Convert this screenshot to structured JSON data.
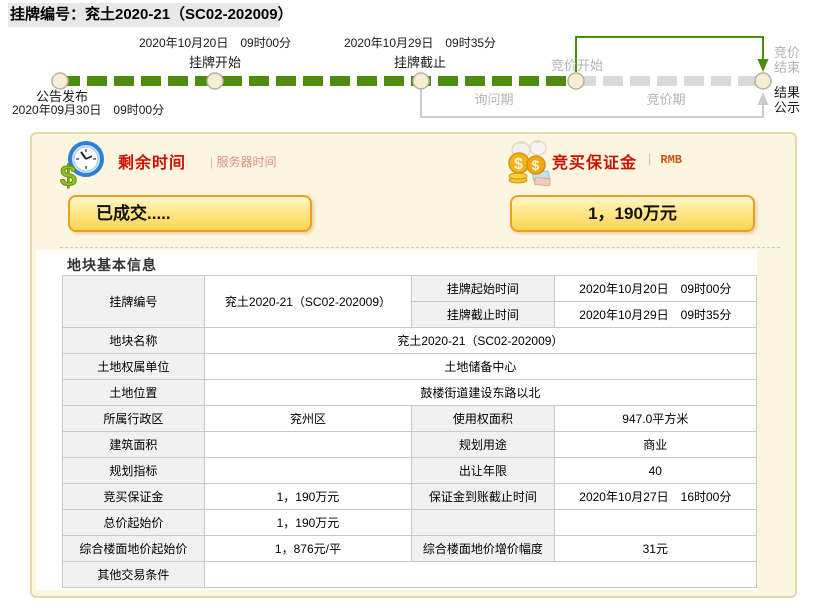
{
  "header": {
    "listing_label": "挂牌编号：兖土2020-21（SC02-202009）"
  },
  "timeline": {
    "announce_label": "公告发布",
    "announce_date": "2020年09月30日　09时00分",
    "listing_start_date": "2020年10月20日　09时00分",
    "listing_start_label": "挂牌开始",
    "listing_end_date": "2020年10月29日　09时35分",
    "listing_end_label": "挂牌截止",
    "bid_start_label": "竞价开始",
    "inquiry_label": "询问期",
    "bidding_label": "竞价期",
    "bid_end_line1": "竞价",
    "bid_end_line2": "结束",
    "result_line1": "结果",
    "result_line2": "公示",
    "colors": {
      "active_green": "#4e8c0e",
      "inactive_gray": "#d9d9d9",
      "node_fill": "#f7edd2"
    }
  },
  "status_panel": {
    "remaining_time_title": "剩余时间",
    "server_time_pipe": "|",
    "server_time_label": "服务器时间",
    "status_value": "已成交.....",
    "deposit_title": "竞买保证金",
    "currency_pipe": "|",
    "currency_label": "RMB",
    "deposit_value": "1，190万元",
    "clock_icon": "clock-with-dollar",
    "money_icon": "money-bags",
    "colors": {
      "title_red": "#cc1100",
      "button_border": "#ef9f1f",
      "panel_bg": "#fcf6e1"
    }
  },
  "info_table": {
    "section_title": "地块基本信息",
    "rows": {
      "listing_no": {
        "label": "挂牌编号",
        "value": "兖土2020-21（SC02-202009）"
      },
      "start_time": {
        "label": "挂牌起始时间",
        "value": "2020年10月20日　09时00分"
      },
      "end_time": {
        "label": "挂牌截止时间",
        "value": "2020年10月29日　09时35分"
      },
      "parcel_name": {
        "label": "地块名称",
        "value": "兖土2020-21（SC02-202009）"
      },
      "owner": {
        "label": "土地权属单位",
        "value": "土地储备中心"
      },
      "location": {
        "label": "土地位置",
        "value": "鼓楼街道建设东路以北"
      },
      "district": {
        "label": "所属行政区",
        "value": "兖州区"
      },
      "use_area": {
        "label": "使用权面积",
        "value": "947.0平方米"
      },
      "building_area": {
        "label": "建筑面积",
        "value": ""
      },
      "planned_use": {
        "label": "规划用途",
        "value": "商业"
      },
      "plan_index": {
        "label": "规划指标",
        "value": ""
      },
      "tenure_years": {
        "label": "出让年限",
        "value": "40"
      },
      "bid_deposit": {
        "label": "竞买保证金",
        "value": "1，190万元"
      },
      "deposit_deadline": {
        "label": "保证金到账截止时间",
        "value": "2020年10月27日　16时00分"
      },
      "total_start_price": {
        "label": "总价起始价",
        "value": "1，190万元"
      },
      "floor_price_start": {
        "label": "综合楼面地价起始价",
        "value": "1，876元/平"
      },
      "floor_price_step": {
        "label": "综合楼面地价增价幅度",
        "value": "31元"
      },
      "other_terms": {
        "label": "其他交易条件",
        "value": ""
      }
    }
  }
}
